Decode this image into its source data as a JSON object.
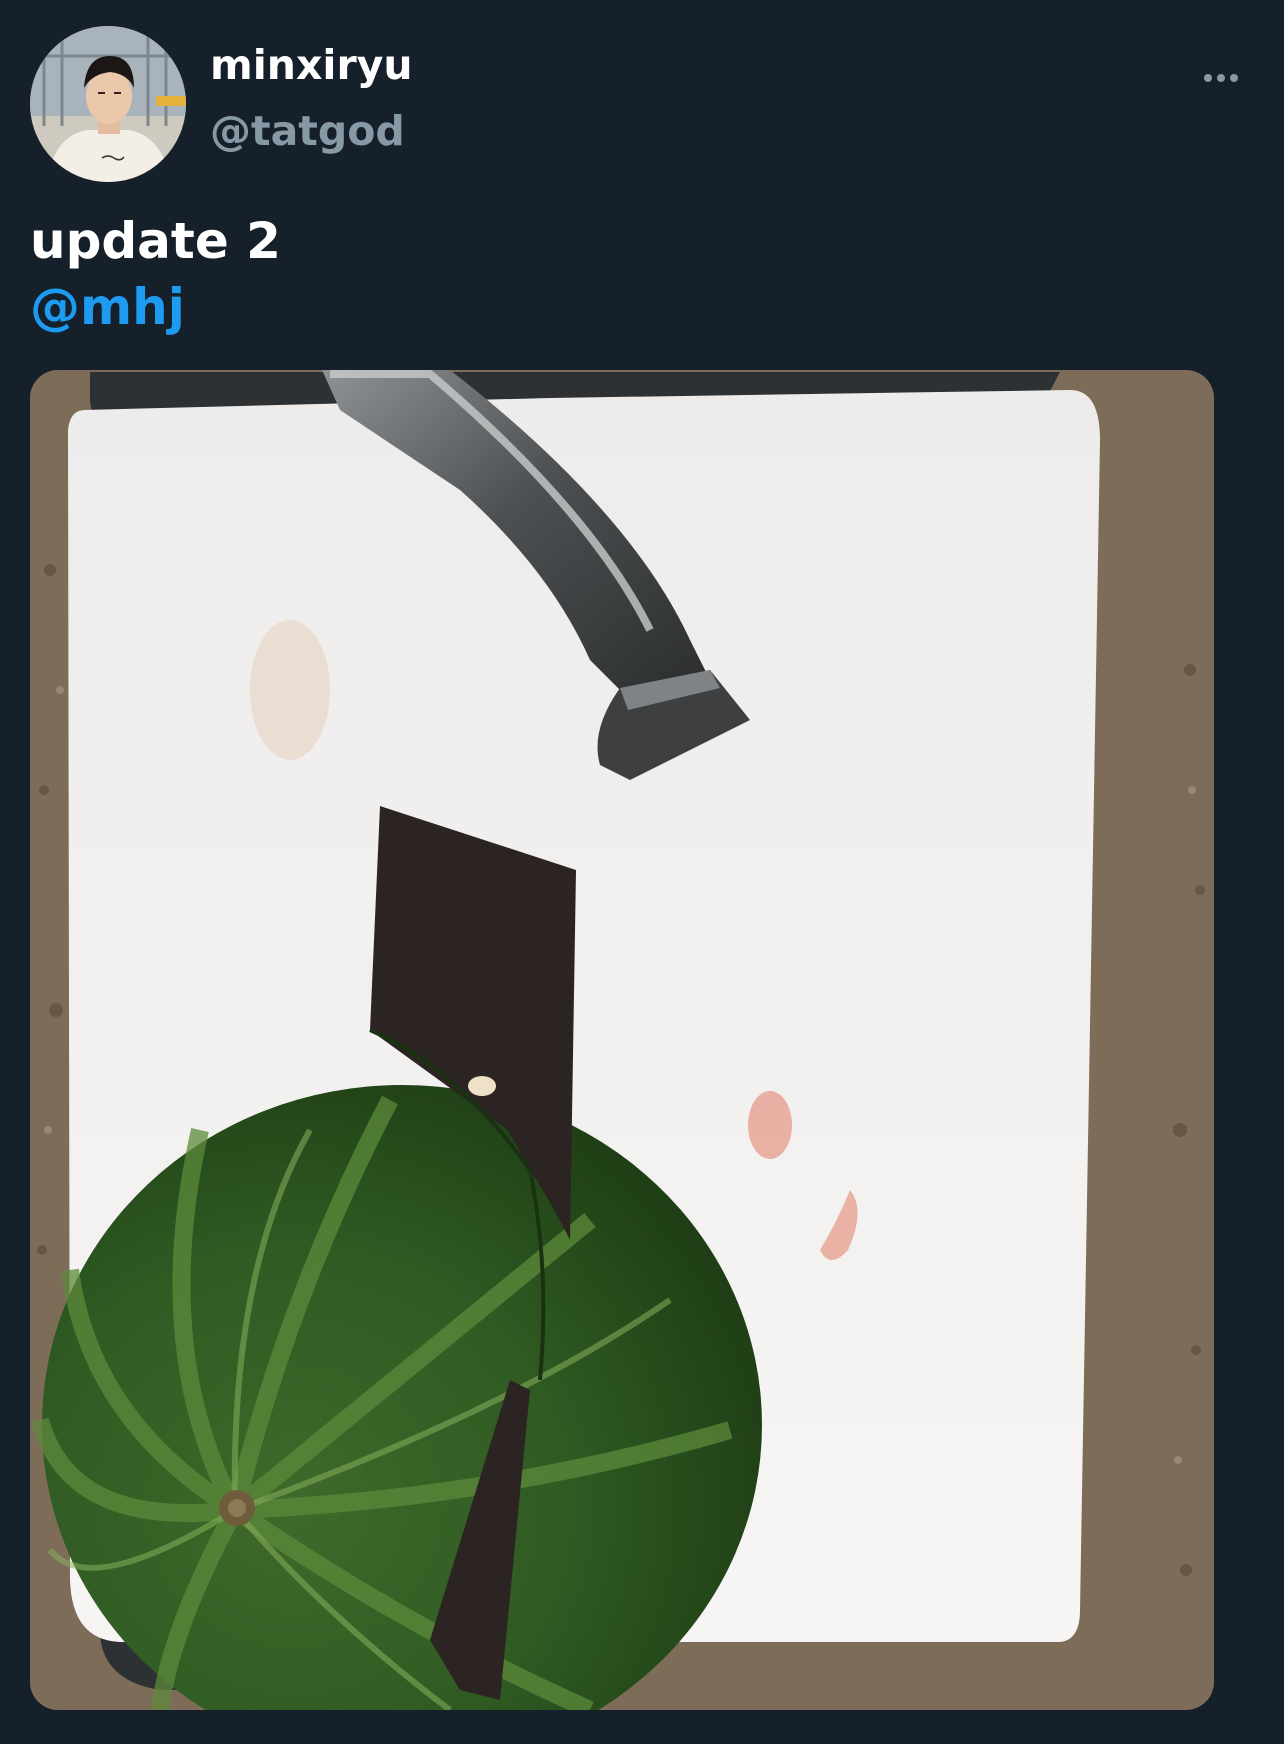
{
  "tweet": {
    "display_name": "minxiryu",
    "handle": "@tatgod",
    "text_line1": "update 2",
    "mention": "@mhj"
  },
  "icons": {
    "more": "more-horizontal-icon"
  },
  "colors": {
    "background": "#15202b",
    "name": "#ffffff",
    "handle": "#8899a6",
    "mention": "#1d9bf0"
  }
}
